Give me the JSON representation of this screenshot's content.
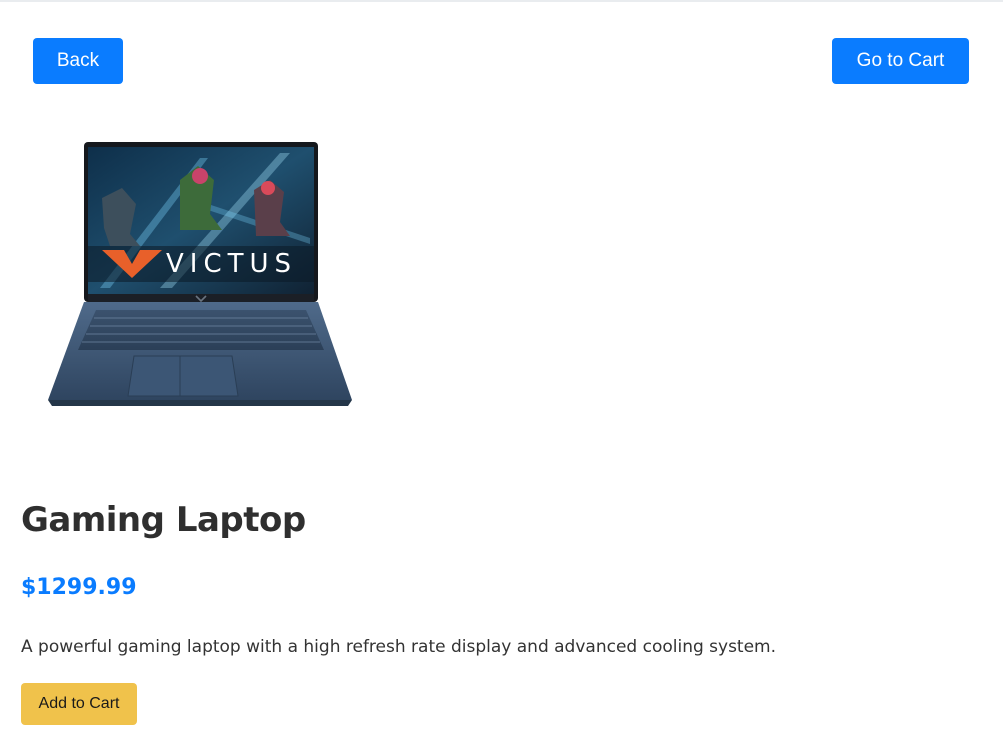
{
  "header": {
    "back_label": "Back",
    "cart_label": "Go to Cart"
  },
  "product": {
    "image_screen_text": "VICTUS",
    "image_alt": "Gaming Laptop",
    "title": "Gaming Laptop",
    "price": "$1299.99",
    "description": "A powerful gaming laptop with a high refresh rate display and advanced cooling system.",
    "add_to_cart_label": "Add to Cart"
  },
  "colors": {
    "primary": "#0a7cff",
    "accent": "#f0c24b",
    "text": "#2f2f2f"
  }
}
